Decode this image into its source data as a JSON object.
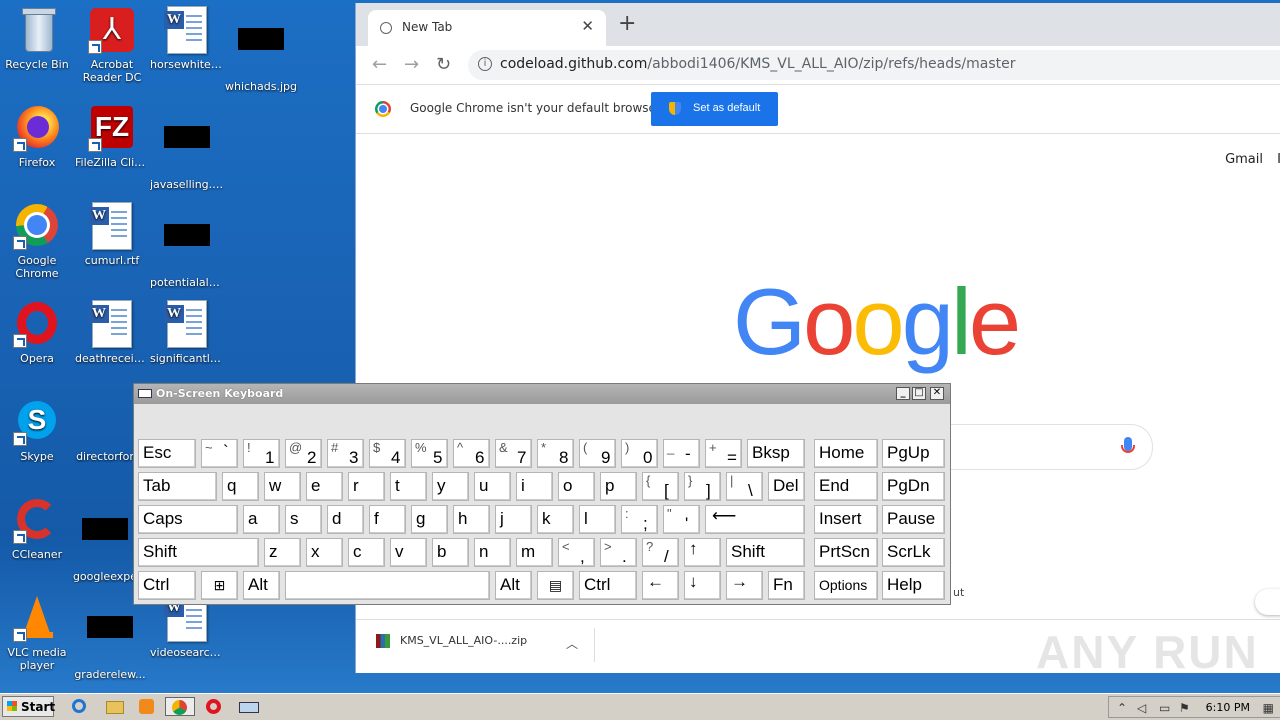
{
  "desktop": {
    "icons": {
      "recycle": "Recycle Bin",
      "acrobat": "Acrobat Reader DC",
      "horsewhite": "horsewhite.rtf",
      "whichads": "whichads.jpg",
      "firefox": "Firefox",
      "filezilla": "FileZilla Client",
      "javaselling": "javaselling.jpg",
      "chrome": "Google Chrome",
      "cumurl": "cumurl.rtf",
      "potentialalo": "potentialalo...",
      "opera": "Opera",
      "deathreceiv": "deathreceiv...",
      "significantle": "significantle...",
      "skype": "Skype",
      "directorfor": "directorfor",
      "ccleaner": "CCleaner",
      "googleexpe": "googleexpe",
      "vlc": "VLC media player",
      "graderelew": "graderelew...",
      "videosearch": "videosearch..."
    }
  },
  "browser": {
    "tab_title": "New Tab",
    "tab_close": "✕",
    "new_tab": "+",
    "url_host": "codeload.github.com",
    "url_path": "/abbodi1406/KMS_VL_ALL_AIO/zip/refs/heads/master",
    "infobar_message": "Google Chrome isn't your default browser",
    "set_default_label": "Set as default",
    "gmail": "Gmail",
    "gmail2": "I",
    "google_letters": [
      "G",
      "o",
      "o",
      "g",
      "l",
      "e"
    ],
    "partial_text": "ut",
    "download_file": "KMS_VL_ALL_AIO-....zip",
    "watermark": "ANY RUN"
  },
  "osk": {
    "title": "On-Screen Keyboard",
    "win_min": "_",
    "win_max": "□",
    "win_close": "✕",
    "keys": {
      "esc": "Esc",
      "tilde_s": "~",
      "tilde_b": "`",
      "k1s": "!",
      "k1": "1",
      "k2s": "@",
      "k2": "2",
      "k3s": "#",
      "k3": "3",
      "k4s": "$",
      "k4": "4",
      "k5s": "%",
      "k5": "5",
      "k6s": "^",
      "k6": "6",
      "k7s": "&",
      "k7": "7",
      "k8s": "*",
      "k8": "8",
      "k9s": "(",
      "k9": "9",
      "k0s": ")",
      "k0": "0",
      "minus_s": "_",
      "minus": "-",
      "eq_s": "+",
      "eq": "=",
      "bksp": "Bksp",
      "home": "Home",
      "pgup": "PgUp",
      "tab": "Tab",
      "q": "q",
      "w": "w",
      "e": "e",
      "r": "r",
      "t": "t",
      "y": "y",
      "u": "u",
      "i": "i",
      "o": "o",
      "p": "p",
      "lbr_s": "{",
      "lbr": "[",
      "rbr_s": "}",
      "rbr": "]",
      "bsl_s": "|",
      "bsl": "\\",
      "del": "Del",
      "end": "End",
      "pgdn": "PgDn",
      "caps": "Caps",
      "a": "a",
      "s": "s",
      "d": "d",
      "f": "f",
      "g": "g",
      "h": "h",
      "j": "j",
      "k": "k",
      "l": "l",
      "semi_s": ":",
      "semi": ";",
      "quote_s": "\"",
      "quote": "'",
      "enter": "⟵",
      "insert": "Insert",
      "pause": "Pause",
      "shift_l": "Shift",
      "z": "z",
      "x": "x",
      "c": "c",
      "v": "v",
      "b": "b",
      "n": "n",
      "m": "m",
      "comma_s": "<",
      "comma": ",",
      "dot_s": ">",
      "dot": ".",
      "slash_s": "?",
      "slash": "/",
      "up": "↑",
      "shift_r": "Shift",
      "prtscn": "PrtScn",
      "scrlk": "ScrLk",
      "ctrl_l": "Ctrl",
      "win": "⊞",
      "alt_l": "Alt",
      "alt_r": "Alt",
      "menu": "▤",
      "ctrl_r": "Ctrl",
      "left": "←",
      "down": "↓",
      "right": "→",
      "fn": "Fn",
      "options": "Options",
      "help": "Help"
    }
  },
  "taskbar": {
    "start": "Start",
    "clock": "6:10 PM"
  }
}
